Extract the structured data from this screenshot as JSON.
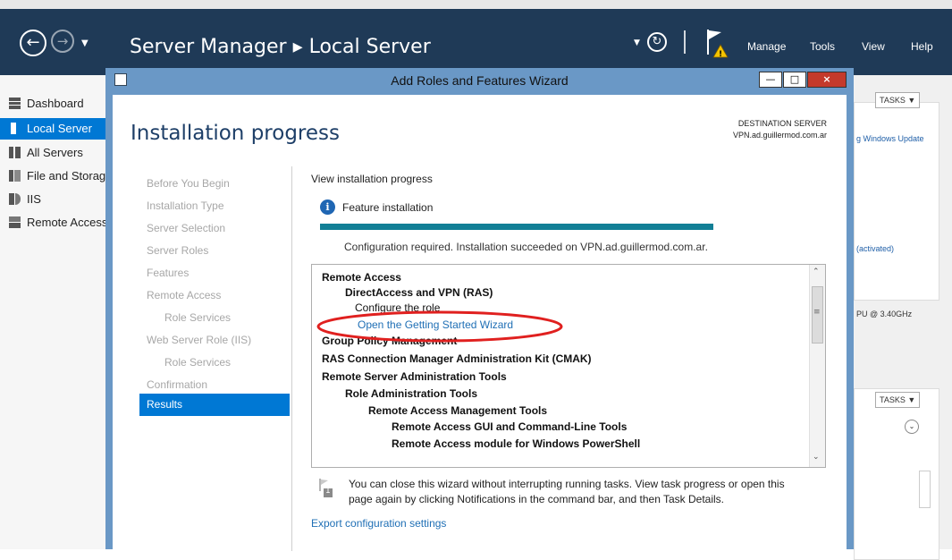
{
  "header": {
    "title": "Server Manager ▸ Local Server",
    "menu": [
      "Manage",
      "Tools",
      "View",
      "Help"
    ]
  },
  "sidebar": {
    "items": [
      {
        "label": "Dashboard",
        "icon": "dashboard-icon"
      },
      {
        "label": "Local Server",
        "icon": "server-icon",
        "selected": true
      },
      {
        "label": "All Servers",
        "icon": "servers-icon"
      },
      {
        "label": "File and Storage Services",
        "icon": "file-storage-icon"
      },
      {
        "label": "IIS",
        "icon": "iis-icon"
      },
      {
        "label": "Remote Access",
        "icon": "remote-access-icon"
      }
    ]
  },
  "background": {
    "tasks_label": "TASKS",
    "fragments": [
      "g Windows Update",
      "(activated)",
      "PU @ 3.40GHz"
    ]
  },
  "wizard": {
    "title": "Add Roles and Features Wizard",
    "heading": "Installation progress",
    "destination_label": "DESTINATION SERVER",
    "destination_server": "VPN.ad.guillermod.com.ar",
    "steps": [
      {
        "label": "Before You Begin",
        "sub": false
      },
      {
        "label": "Installation Type",
        "sub": false
      },
      {
        "label": "Server Selection",
        "sub": false
      },
      {
        "label": "Server Roles",
        "sub": false
      },
      {
        "label": "Features",
        "sub": false
      },
      {
        "label": "Remote Access",
        "sub": false
      },
      {
        "label": "Role Services",
        "sub": true
      },
      {
        "label": "Web Server Role (IIS)",
        "sub": false
      },
      {
        "label": "Role Services",
        "sub": true
      },
      {
        "label": "Confirmation",
        "sub": false
      },
      {
        "label": "Results",
        "sub": false,
        "selected": true
      }
    ],
    "view_progress_label": "View installation progress",
    "feature_installation_label": "Feature installation",
    "progress": 1.0,
    "status_message": "Configuration required. Installation succeeded on VPN.ad.guillermod.com.ar.",
    "results": [
      {
        "text": "Remote Access",
        "bold": true,
        "indent": 0
      },
      {
        "text": "DirectAccess and VPN (RAS)",
        "bold": true,
        "indent": 1
      },
      {
        "text": "Configure the role",
        "bold": false,
        "indent": 2
      },
      {
        "text": "Open the Getting Started Wizard",
        "bold": false,
        "indent": 2,
        "link": true
      },
      {
        "text": "Group Policy Management",
        "bold": true,
        "indent": 0
      },
      {
        "text": "RAS Connection Manager Administration Kit (CMAK)",
        "bold": true,
        "indent": 0
      },
      {
        "text": "Remote Server Administration Tools",
        "bold": true,
        "indent": 0
      },
      {
        "text": "Role Administration Tools",
        "bold": true,
        "indent": 1
      },
      {
        "text": "Remote Access Management Tools",
        "bold": true,
        "indent": 2
      },
      {
        "text": "Remote Access GUI and Command-Line Tools",
        "bold": true,
        "indent": 3
      },
      {
        "text": "Remote Access module for Windows PowerShell",
        "bold": true,
        "indent": 3
      }
    ],
    "notice_badge": "1",
    "notice_line1": "You can close this wizard without interrupting running tasks. View task progress or open this",
    "notice_line2": "page again by clicking Notifications in the command bar, and then Task Details.",
    "export_link": "Export configuration settings"
  },
  "colors": {
    "header_bg": "#1f3a57",
    "selection": "#0078d4",
    "link": "#1f6fb5",
    "progress": "#127f96",
    "annotation": "#e0201f"
  }
}
